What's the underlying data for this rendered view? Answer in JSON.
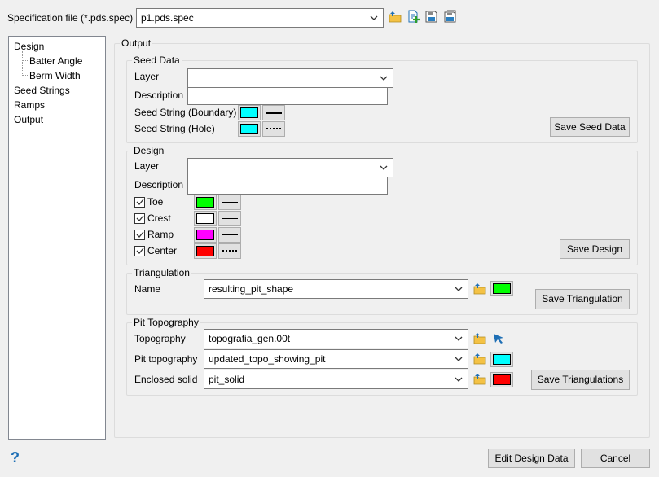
{
  "spec": {
    "label": "Specification file (*.pds.spec)",
    "value": "p1.pds.spec",
    "icons": [
      "open-folder-icon",
      "new-file-icon",
      "save-icon",
      "save-as-icon"
    ]
  },
  "tree": {
    "items": [
      {
        "label": "Design"
      },
      {
        "label": "Batter Angle"
      },
      {
        "label": "Berm Width"
      },
      {
        "label": "Seed Strings"
      },
      {
        "label": "Ramps"
      },
      {
        "label": "Output"
      }
    ]
  },
  "output": {
    "title": "Output",
    "seed": {
      "title": "Seed Data",
      "layer_label": "Layer",
      "layer_value": "",
      "desc_label": "Description",
      "desc_value": "",
      "boundary_label": "Seed String (Boundary)",
      "boundary_color": "#00ffff",
      "hole_label": "Seed String (Hole)",
      "hole_color": "#00ffff",
      "save": "Save Seed Data"
    },
    "design": {
      "title": "Design",
      "layer_label": "Layer",
      "desc_label": "Description",
      "items": [
        {
          "label": "Toe",
          "checked": true,
          "color": "#00ff00"
        },
        {
          "label": "Crest",
          "checked": true,
          "color": "#ffffff"
        },
        {
          "label": "Ramp",
          "checked": true,
          "color": "#ff00ff"
        },
        {
          "label": "Center",
          "checked": true,
          "color": "#ff0000"
        }
      ],
      "save": "Save Design"
    },
    "tri": {
      "title": "Triangulation",
      "name_label": "Name",
      "name_value": "resulting_pit_shape",
      "color": "#00ff00",
      "save": "Save Triangulation"
    },
    "pit": {
      "title": "Pit Topography",
      "rows": [
        {
          "label": "Topography",
          "value": "topografia_gen.00t"
        },
        {
          "label": "Pit topography",
          "value": "updated_topo_showing_pit",
          "color": "#00ffff"
        },
        {
          "label": "Enclosed solid",
          "value": "pit_solid",
          "color": "#ff0000"
        }
      ],
      "save": "Save Triangulations"
    }
  },
  "footer": {
    "help": "?",
    "edit": "Edit Design Data",
    "cancel": "Cancel"
  }
}
